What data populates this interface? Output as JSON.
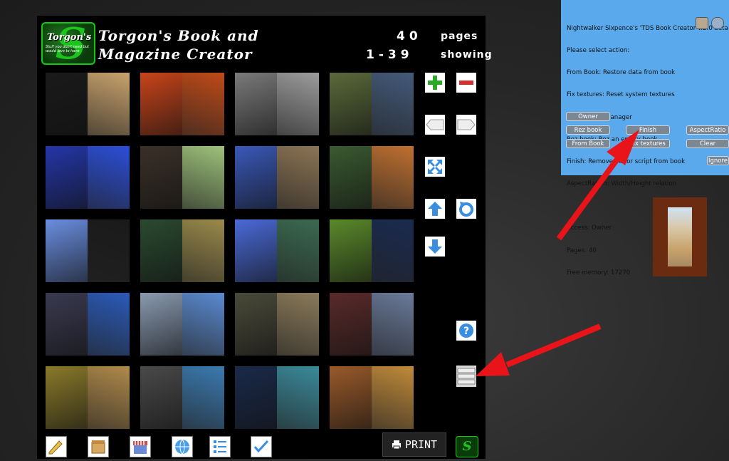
{
  "board": {
    "title_line1": "Torgon's Book and",
    "title_line2": "Magazine Creator",
    "logo_brand": "Torgon's",
    "logo_slogan": "Stuff you don't need but would love to have",
    "pages_count": "40",
    "pages_label": "pages",
    "showing_range": "1-39",
    "showing_label": "showing",
    "print_label": "PRINT",
    "thumbnails": [
      {
        "l": "#1a1a1a",
        "r": "#c9a36c"
      },
      {
        "l": "#c9441a",
        "r": "#c04a18"
      },
      {
        "l": "#7a7a7a",
        "r": "#9c9c9c"
      },
      {
        "l": "#5a6a3a",
        "r": "#445a7a"
      },
      {
        "l": "#2436a8",
        "r": "#2b4ed8"
      },
      {
        "l": "#3a3028",
        "r": "#9ec27a"
      },
      {
        "l": "#3a58b8",
        "r": "#8c7454"
      },
      {
        "l": "#3a5a30",
        "r": "#c07030"
      },
      {
        "l": "#6a8ee0",
        "r": "#1a1a1a"
      },
      {
        "l": "#2a4a30",
        "r": "#9a8a4a"
      },
      {
        "l": "#4a6ad8",
        "r": "#3a6a50"
      },
      {
        "l": "#5a8a2a",
        "r": "#1a2a50"
      },
      {
        "l": "#3a3a50",
        "r": "#2a5ab8"
      },
      {
        "l": "#8a9ab0",
        "r": "#5a8ad0"
      },
      {
        "l": "#4a4a3a",
        "r": "#8a7a5a"
      },
      {
        "l": "#5a2a2a",
        "r": "#6a7a9a"
      },
      {
        "l": "#8a7a2a",
        "r": "#b08a4a"
      },
      {
        "l": "#4a4a4a",
        "r": "#3a7ab0"
      },
      {
        "l": "#1a2a4a",
        "r": "#3a8a9a"
      },
      {
        "l": "#9a5a2a",
        "r": "#c08a3a"
      }
    ]
  },
  "dialog": {
    "line1": "Nightwalker Sixpence's 'TDS Book Creator v.2.0 beta 1'",
    "line2": "Please select action:",
    "line3": "From Book: Restore data from book",
    "line4": "Fix textures: Reset system textures",
    "line5": "Clear: Clear manager",
    "line6": "Rez book: Rez an empty book",
    "line7": "Finish: Remove editor script from book",
    "line8": "AspectRation: Width/Height relation",
    "line9": "Access: Owner",
    "line10": "Pages: 40",
    "line11": "Free memory: 17270",
    "btn_owner": "Owner",
    "btn_rez": "Rez book",
    "btn_finish": "Finish",
    "btn_aspect": "AspectRatio",
    "btn_from": "From Book",
    "btn_fix": "Fix textures",
    "btn_clear": "Clear",
    "btn_ignore": "Ignore"
  },
  "colors": {
    "board_bg": "#000000",
    "dialog_bg": "#5aa9ec",
    "arrow": "#e8141a",
    "logo_green": "#1ec41e",
    "plus_green": "#2aa82a",
    "minus_red": "#d43030",
    "tool_blue": "#3a8ee0"
  }
}
